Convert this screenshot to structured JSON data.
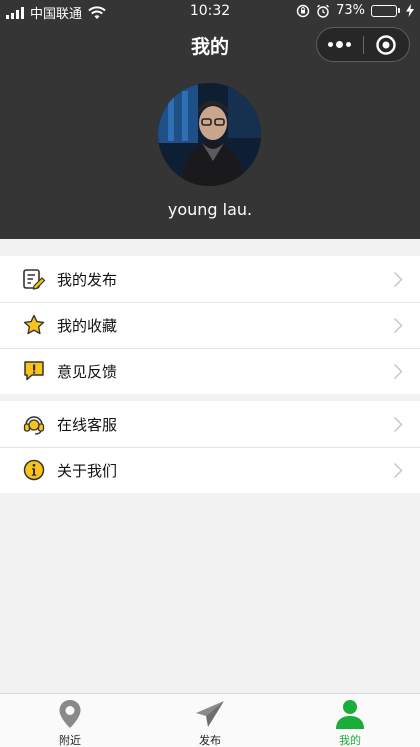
{
  "status_bar": {
    "carrier": "中国联通",
    "time": "10:32",
    "battery": "73%",
    "battery_level": 0.73,
    "battery_color": "#4cd964"
  },
  "nav": {
    "title": "我的"
  },
  "profile": {
    "name": "young lau."
  },
  "menu_groups": [
    {
      "items": [
        {
          "label": "我的发布",
          "icon": "edit-document-icon"
        },
        {
          "label": "我的收藏",
          "icon": "star-icon"
        },
        {
          "label": "意见反馈",
          "icon": "feedback-icon"
        }
      ]
    },
    {
      "items": [
        {
          "label": "在线客服",
          "icon": "headset-icon"
        },
        {
          "label": "关于我们",
          "icon": "info-icon"
        }
      ]
    }
  ],
  "tabbar": {
    "tabs": [
      {
        "label": "附近",
        "icon": "location-pin-icon",
        "active": false
      },
      {
        "label": "发布",
        "icon": "paper-plane-icon",
        "active": false
      },
      {
        "label": "我的",
        "icon": "user-icon",
        "active": true
      }
    ]
  },
  "colors": {
    "header_bg": "#353535",
    "accent_yellow": "#f8c41b",
    "active_green": "#1aad3b"
  }
}
